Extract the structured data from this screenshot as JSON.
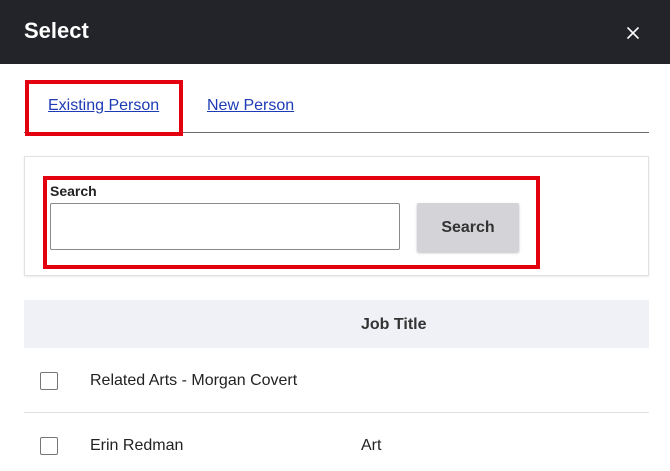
{
  "dialog": {
    "title": "Select",
    "close_icon": "close-icon"
  },
  "tabs": [
    {
      "label": "Existing Person",
      "active": true
    },
    {
      "label": "New Person",
      "active": false
    }
  ],
  "search": {
    "label": "Search",
    "value": "",
    "placeholder": "",
    "button_label": "Search"
  },
  "table": {
    "columns": [
      "",
      "",
      "Job Title"
    ],
    "rows": [
      {
        "name": "Related Arts - Morgan Covert",
        "job_title": "",
        "checked": false
      },
      {
        "name": "Erin Redman",
        "job_title": "Art",
        "checked": false
      }
    ]
  },
  "colors": {
    "titlebar": "#232429",
    "link": "#1d3bb4",
    "highlight": "#e3000f",
    "header_bg": "#f0f1f6",
    "button_bg": "#d4d4d8"
  }
}
